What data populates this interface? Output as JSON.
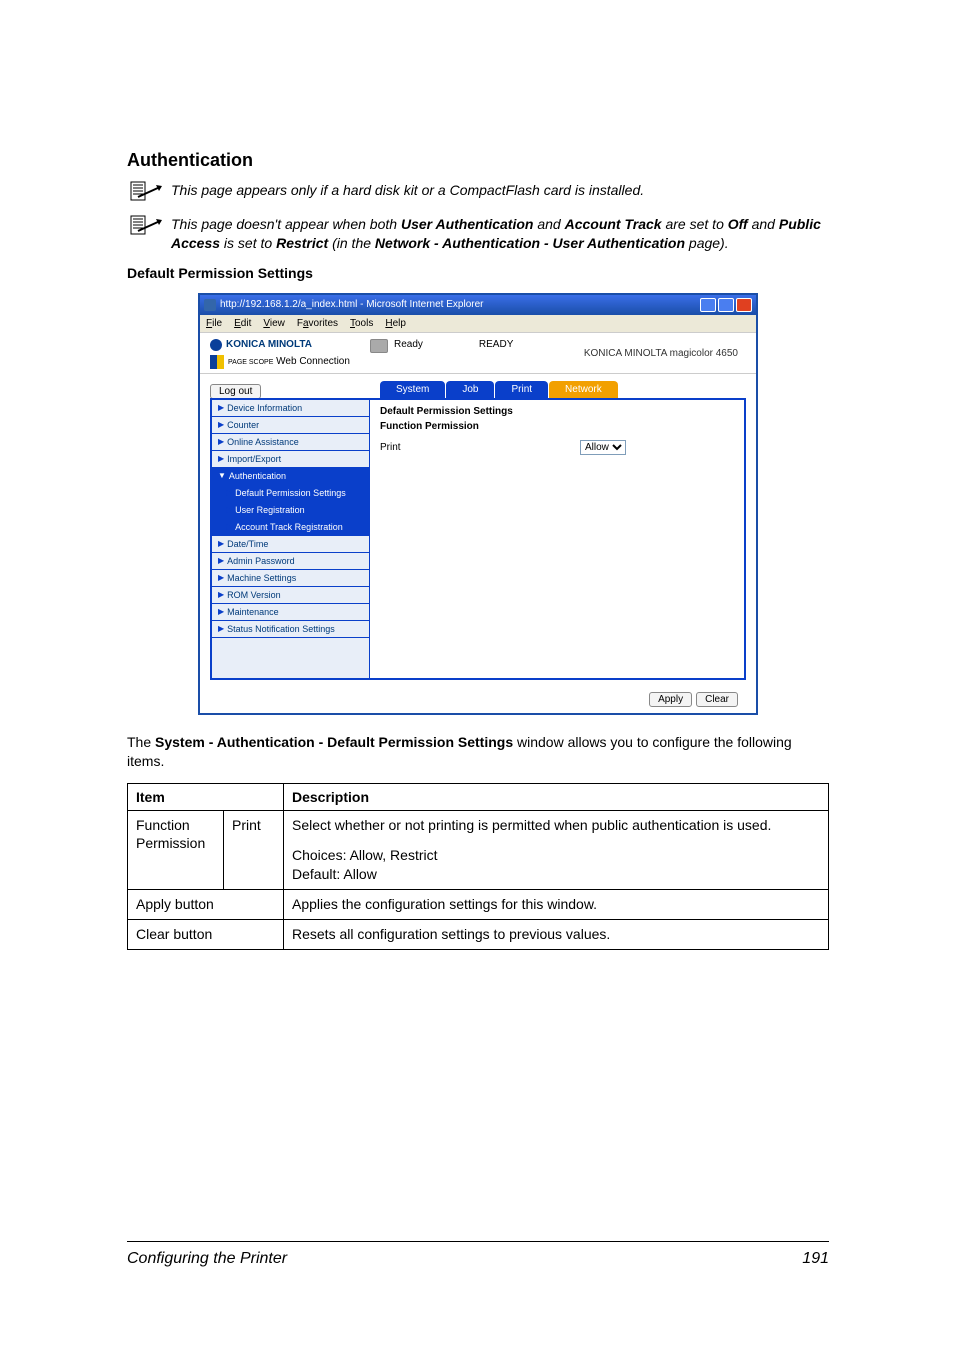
{
  "heading": "Authentication",
  "note1": {
    "pre": "This page appears only if a hard disk kit or a CompactFlash card is installed."
  },
  "note2": {
    "p1": "This page doesn't appear when both ",
    "b1": "User Authentication",
    "p2": " and ",
    "b2": "Account Track",
    "p3": " are set to ",
    "b3": "Off",
    "p4": " and ",
    "b4": "Public Access",
    "p5": " is set to ",
    "b5": "Restrict",
    "p6": " (in the ",
    "b6": "Network - Authentication - User Authentication",
    "p7": " page)."
  },
  "subheading": "Default Permission Settings",
  "screenshot": {
    "title": "http://192.168.1.2/a_index.html - Microsoft Internet Explorer",
    "menu": {
      "file": "File",
      "edit": "Edit",
      "view": "View",
      "favorites": "Favorites",
      "tools": "Tools",
      "help": "Help"
    },
    "brand": "KONICA MINOLTA",
    "webconn_a": "PAGE SCOPE",
    "webconn_b": " Web Connection",
    "ready_a": "Ready",
    "ready_b": "READY",
    "device": "KONICA MINOLTA magicolor 4650",
    "logout": "Log out",
    "tabs": {
      "system": "System",
      "job": "Job",
      "print": "Print",
      "network": "Network"
    },
    "nav": {
      "devinfo": "Device Information",
      "counter": "Counter",
      "online": "Online Assistance",
      "impexp": "Import/Export",
      "auth": "Authentication",
      "defperm": "Default Permission Settings",
      "userreg": "User Registration",
      "acctreg": "Account Track Registration",
      "datetime": "Date/Time",
      "adminpw": "Admin Password",
      "machine": "Machine Settings",
      "romver": "ROM Version",
      "maint": "Maintenance",
      "statusnotif": "Status Notification Settings"
    },
    "content": {
      "title": "Default Permission Settings",
      "head": "Function Permission",
      "printlbl": "Print",
      "printval": "Allow"
    },
    "apply": "Apply",
    "clear": "Clear"
  },
  "body": {
    "p1": "The ",
    "b1": "System - Authentication - Default Permission Settings",
    "p2": " window allows you to configure the following items."
  },
  "table": {
    "h_item": "Item",
    "h_desc": "Description",
    "r1c1a": "Function Permission",
    "r1c1b": "Print",
    "r1c2a": "Select whether or not printing is permitted when public authentication is used.",
    "r1c2b": "Choices: Allow, Restrict",
    "r1c2c": "Default:  Allow",
    "r2c1": "Apply button",
    "r2c2": "Applies the configuration settings for this window.",
    "r3c1": "Clear button",
    "r3c2": "Resets all configuration settings to previous values."
  },
  "footer": {
    "left": "Configuring the Printer",
    "right": "191"
  }
}
